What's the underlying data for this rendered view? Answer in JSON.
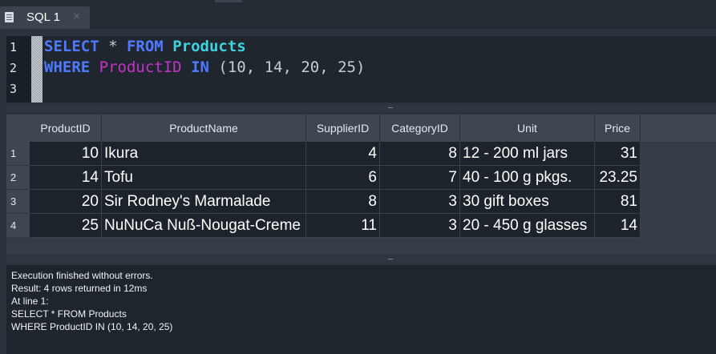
{
  "tab": {
    "label": "SQL 1",
    "close": "×",
    "icon": "sql-document-icon"
  },
  "editor": {
    "line_numbers": [
      "1",
      "2",
      "3"
    ],
    "line1": {
      "kw1": "SELECT",
      "star": " * ",
      "kw2": "FROM",
      "sp": " ",
      "table": "Products"
    },
    "line2": {
      "kw1": "WHERE",
      "sp1": " ",
      "column": "ProductID",
      "sp2": " ",
      "kw2": "IN",
      "values": " (10, 14, 20, 25)"
    }
  },
  "grid": {
    "columns": [
      "ProductID",
      "ProductName",
      "SupplierID",
      "CategoryID",
      "Unit",
      "Price"
    ],
    "rows": [
      {
        "n": "1",
        "cells": [
          "10",
          "Ikura",
          "4",
          "8",
          "12 - 200 ml jars",
          "31"
        ]
      },
      {
        "n": "2",
        "cells": [
          "14",
          "Tofu",
          "6",
          "7",
          "40 - 100 g pkgs.",
          "23.25"
        ]
      },
      {
        "n": "3",
        "cells": [
          "20",
          "Sir Rodney's Marmalade",
          "8",
          "3",
          "30 gift boxes",
          "81"
        ]
      },
      {
        "n": "4",
        "cells": [
          "25",
          "NuNuCa Nuß-Nougat-Creme",
          "11",
          "3",
          "20 - 450 g glasses",
          "14"
        ]
      }
    ]
  },
  "messages": {
    "line1": "Execution finished without errors.",
    "line2": "Result: 4 rows returned in 12ms",
    "line3": "At line 1:",
    "line4": "SELECT * FROM Products",
    "line5": "WHERE ProductID IN (10, 14, 20, 25)"
  },
  "colors": {
    "keyword": "#4f79ff",
    "table": "#3fd2e0",
    "column": "#c534c8",
    "background": "#2b333d"
  }
}
